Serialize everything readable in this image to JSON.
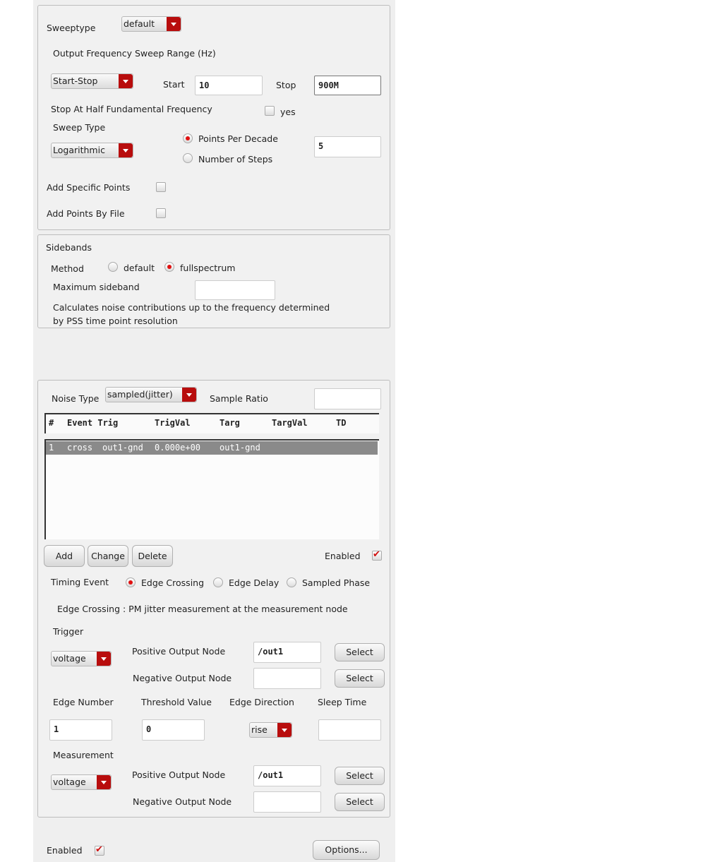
{
  "sweep": {
    "sweeptype_label": "Sweeptype",
    "sweeptype_value": "default",
    "range_label": "Output Frequency Sweep Range (Hz)",
    "range_mode": "Start-Stop",
    "start_label": "Start",
    "start_value": "10",
    "stop_label": "Stop",
    "stop_value": "900M",
    "half_label": "Stop At Half Fundamental Frequency",
    "half_yes": "yes",
    "sweep_type_label": "Sweep Type",
    "sweep_type_value": "Logarithmic",
    "ppd_label": "Points Per Decade",
    "steps_label": "Number of Steps",
    "points_value": "5",
    "specific_label": "Add Specific Points",
    "file_label": "Add Points By File"
  },
  "sidebands": {
    "title": "Sidebands",
    "method_label": "Method",
    "opt_default": "default",
    "opt_full": "fullspectrum",
    "max_label": "Maximum sideband",
    "max_value": "",
    "note1": "Calculates noise contributions up to the frequency determined",
    "note2": "by PSS time point resolution"
  },
  "noise": {
    "type_label": "Noise Type",
    "type_value": "sampled(jitter)",
    "ratio_label": "Sample Ratio",
    "ratio_value": "",
    "columns": [
      "#",
      "Event Trig",
      "TrigVal",
      "Targ",
      "TargVal",
      "TD"
    ],
    "rows": [
      {
        "num": "1",
        "event": "cross",
        "trig": "out1-gnd",
        "trigval": "0.000e+00",
        "targ": "out1-gnd"
      }
    ],
    "add": "Add",
    "change": "Change",
    "delete": "Delete",
    "enabled": "Enabled",
    "timing_label": "Timing Event",
    "timing_opts": [
      "Edge Crossing",
      "Edge Delay",
      "Sampled Phase"
    ],
    "desc": "Edge Crossing : PM jitter measurement at the measurement node",
    "trigger": {
      "label": "Trigger",
      "type": "voltage",
      "pos_label": "Positive Output Node",
      "pos_value": "/out1",
      "neg_label": "Negative Output Node",
      "neg_value": "",
      "select": "Select"
    },
    "edge_number_label": "Edge Number",
    "edge_number": "1",
    "threshold_label": "Threshold Value",
    "threshold": "0",
    "direction_label": "Edge Direction",
    "direction": "rise",
    "sleep_label": "Sleep Time",
    "sleep": "",
    "measurement": {
      "label": "Measurement",
      "type": "voltage",
      "pos_label": "Positive Output Node",
      "pos_value": "/out1",
      "neg_label": "Negative Output Node",
      "neg_value": "",
      "select": "Select"
    }
  },
  "footer": {
    "enabled": "Enabled",
    "options": "Options..."
  }
}
